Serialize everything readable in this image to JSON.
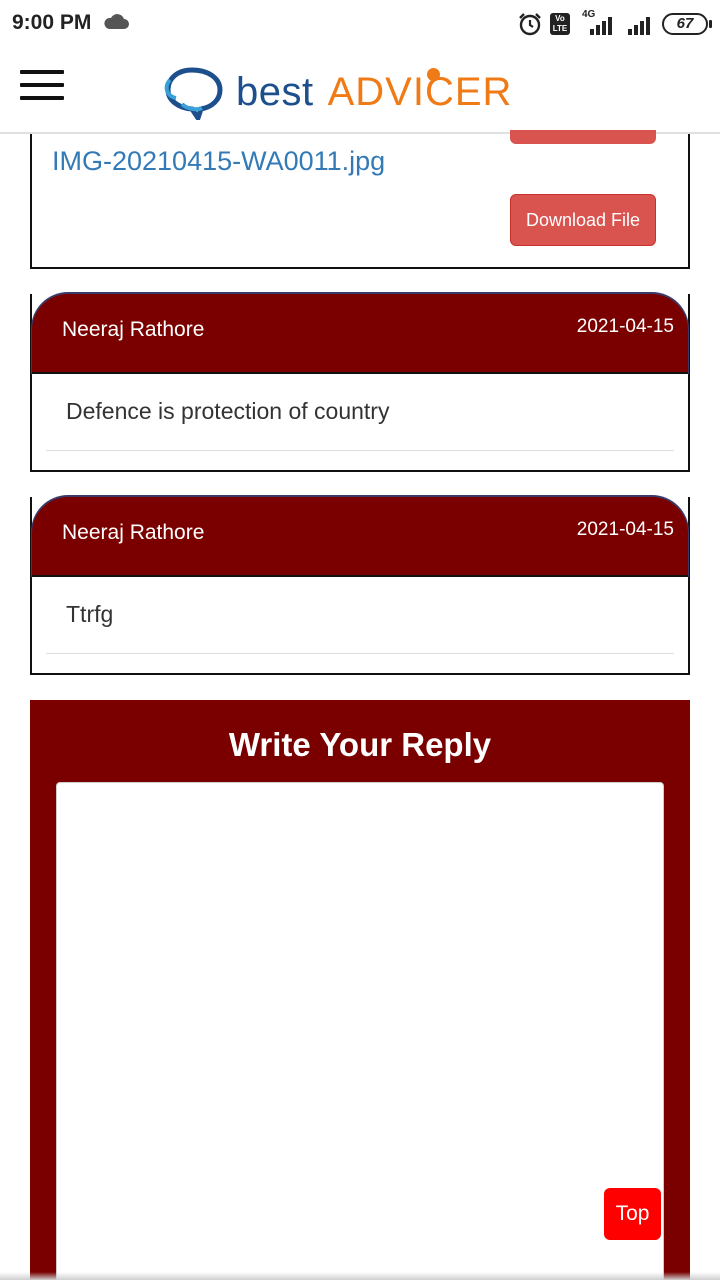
{
  "status_bar": {
    "time": "9:00 PM",
    "network_label": "4G",
    "volte_label": "Vo LTE",
    "battery": "67",
    "icons": [
      "cloud-icon",
      "alarm-icon",
      "volte-icon",
      "signal-icon",
      "battery-icon"
    ]
  },
  "header": {
    "logo_part1": "best",
    "logo_part2": "ADVICER",
    "menu_icon": "hamburger-icon"
  },
  "attachment": {
    "file_name": "IMG-20210415-WA0011.jpg",
    "download_label": "Download File"
  },
  "comments": [
    {
      "author": "Neeraj Rathore",
      "date": "2021-04-15",
      "text": "Defence is protection of country"
    },
    {
      "author": "Neeraj Rathore",
      "date": "2021-04-15",
      "text": "Ttrfg"
    }
  ],
  "reply": {
    "title": "Write Your Reply",
    "value": ""
  },
  "top_button": "Top",
  "colors": {
    "brand_blue": "#1d4f8c",
    "brand_orange": "#f07b16",
    "maroon": "#7a0000",
    "danger": "#d9534f",
    "top_red": "#ff0000"
  }
}
